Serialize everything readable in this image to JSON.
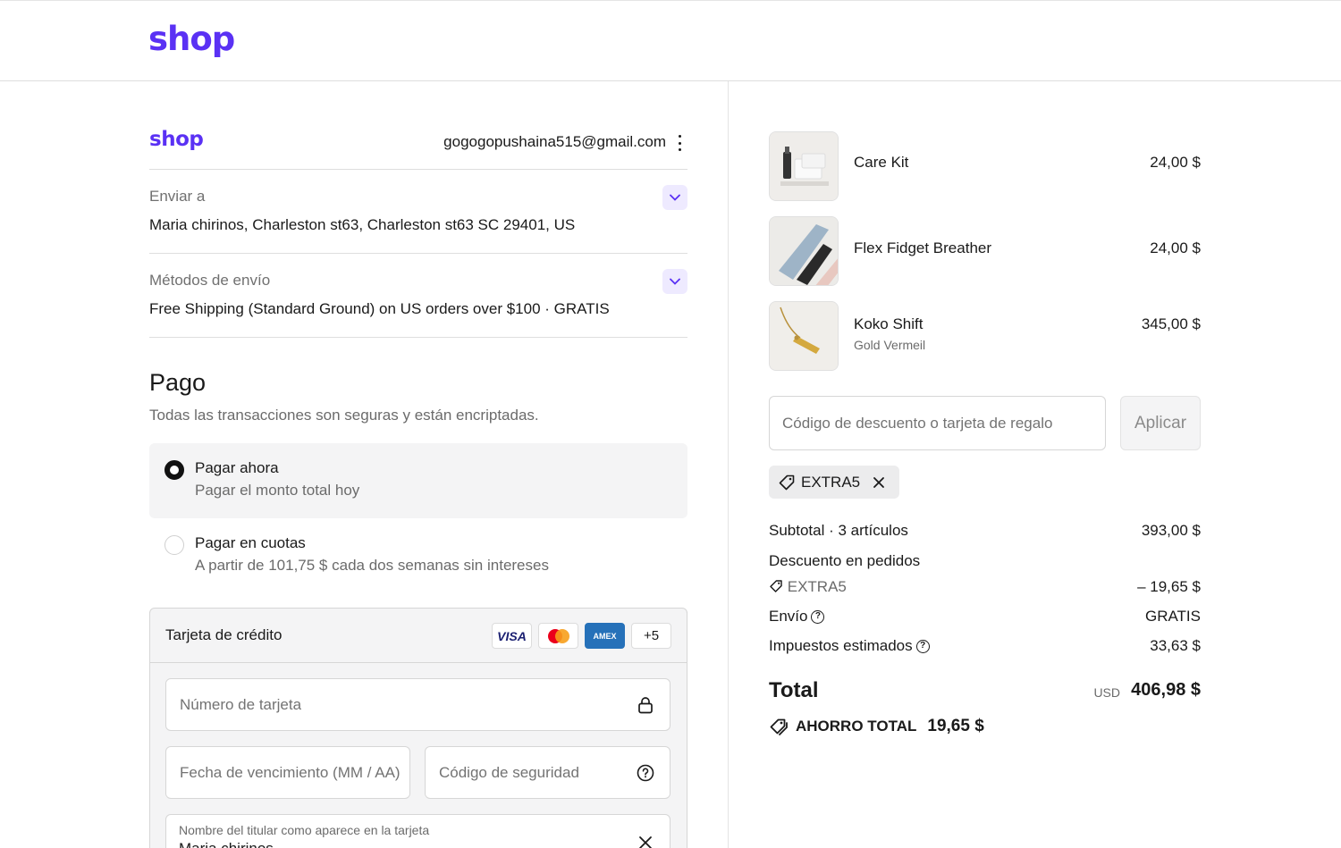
{
  "header": {
    "logo": "shop"
  },
  "account": {
    "logo": "shop",
    "email": "gogogopushaina515@gmail.com"
  },
  "shipping": {
    "label": "Enviar a",
    "value": "Maria chirinos, Charleston st63, Charleston st63 SC 29401, US"
  },
  "methods": {
    "label": "Métodos de envío",
    "value": "Free Shipping (Standard Ground) on US orders over $100 · GRATIS"
  },
  "payment": {
    "title": "Pago",
    "subtitle": "Todas las transacciones son seguras y están encriptadas.",
    "options": [
      {
        "title": "Pagar ahora",
        "subtitle": "Pagar el monto total hoy",
        "selected": true
      },
      {
        "title": "Pagar en cuotas",
        "subtitle": "A partir de 101,75 $ cada dos semanas sin intereses",
        "selected": false
      }
    ],
    "card": {
      "title": "Tarjeta de crédito",
      "brands": [
        "VISA",
        "mastercard",
        "AMEX",
        "+5"
      ],
      "number_placeholder": "Número de tarjeta",
      "expiry_placeholder": "Fecha de vencimiento (MM / AA)",
      "cvv_placeholder": "Código de seguridad",
      "name_label": "Nombre del titular como aparece en la tarjeta",
      "name_value": "Maria chirinos"
    }
  },
  "cart": {
    "items": [
      {
        "name": "Care Kit",
        "variant": "",
        "price": "24,00 $"
      },
      {
        "name": "Flex Fidget Breather",
        "variant": "",
        "price": "24,00 $"
      },
      {
        "name": "Koko Shift",
        "variant": "Gold Vermeil",
        "price": "345,00 $"
      }
    ],
    "discount_placeholder": "Código de descuento o tarjeta de regalo",
    "apply_label": "Aplicar",
    "applied_code": "EXTRA5",
    "subtotal_label": "Subtotal · 3 artículos",
    "subtotal_value": "393,00 $",
    "order_discount_label": "Descuento en pedidos",
    "discount_code": "EXTRA5",
    "discount_value": "– 19,65 $",
    "shipping_label": "Envío",
    "shipping_value": "GRATIS",
    "taxes_label": "Impuestos estimados",
    "taxes_value": "33,63 $",
    "total_label": "Total",
    "currency": "USD",
    "total_value": "406,98 $",
    "savings_label": "AHORRO TOTAL",
    "savings_value": "19,65 $"
  },
  "colors": {
    "brand": "#5a31f4",
    "accent_bg": "#eeeaff",
    "selected_bg": "#f4f4f5"
  }
}
